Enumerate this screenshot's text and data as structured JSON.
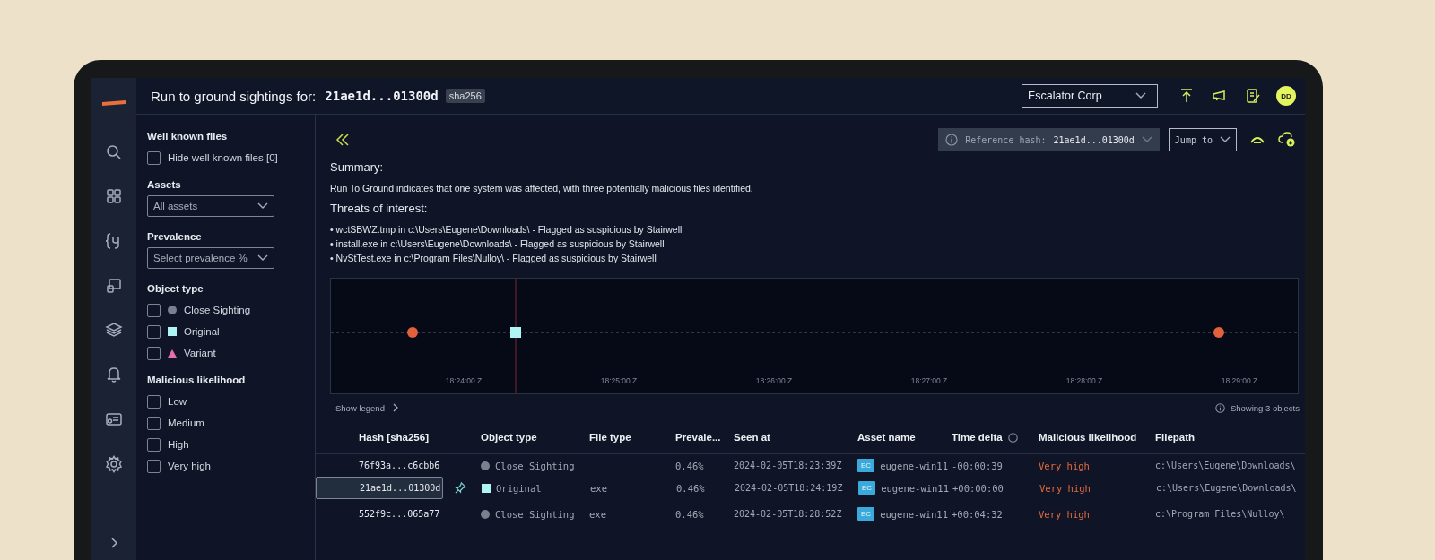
{
  "header": {
    "title": "Run to ground sightings for:",
    "hash": "21ae1d...01300d",
    "hash_type": "sha256",
    "org_select": "Escalator Corp",
    "avatar": "DD"
  },
  "filters": {
    "well_known": {
      "heading": "Well known files",
      "label": "Hide well known files [0]",
      "checked": false
    },
    "assets": {
      "heading": "Assets",
      "value": "All assets"
    },
    "prevalence": {
      "heading": "Prevalence",
      "placeholder": "Select prevalence %"
    },
    "object_type": {
      "heading": "Object type",
      "items": [
        {
          "label": "Close Sighting",
          "kind": "circle",
          "color": "#7a808e",
          "checked": false
        },
        {
          "label": "Original",
          "kind": "square",
          "color": "#aef4f4",
          "checked": false
        },
        {
          "label": "Variant",
          "kind": "triangle",
          "color": "#e56fae",
          "checked": false
        }
      ]
    },
    "malicious": {
      "heading": "Malicious likelihood",
      "items": [
        {
          "label": "Low",
          "checked": false
        },
        {
          "label": "Medium",
          "checked": false
        },
        {
          "label": "High",
          "checked": false
        },
        {
          "label": "Very high",
          "checked": false
        }
      ]
    }
  },
  "toolbar": {
    "reference_label": "Reference hash:",
    "reference_value": "21ae1d...01300d",
    "jump_to": "Jump to"
  },
  "summary": {
    "heading": "Summary:",
    "text": "Run To Ground indicates that one system was affected, with three potentially malicious files identified.",
    "threats_heading": "Threats of interest:",
    "threats": [
      "• wctSBWZ.tmp in c:\\Users\\Eugene\\Downloads\\ - Flagged as suspicious by Stairwell",
      "• install.exe in c:\\Users\\Eugene\\Downloads\\ - Flagged as suspicious by Stairwell",
      "• NvStTest.exe in c:\\Program Files\\Nulloy\\ - Flagged as suspicious by Stairwell"
    ]
  },
  "timeline": {
    "tick_labels": [
      "18:24:00 Z",
      "18:25:00 Z",
      "18:26:00 Z",
      "18:27:00 Z",
      "18:28:00 Z",
      "18:29:00 Z"
    ],
    "show_legend": "Show legend",
    "count": "Showing 3 objects"
  },
  "table": {
    "columns": [
      {
        "label": "Hash [sha256]",
        "info": false
      },
      {
        "label": "Object type",
        "info": false
      },
      {
        "label": "File type",
        "info": false
      },
      {
        "label": "Prevale...",
        "info": false
      },
      {
        "label": "Seen at",
        "info": false
      },
      {
        "label": "Asset name",
        "info": false
      },
      {
        "label": "Time delta",
        "info": true
      },
      {
        "label": "Malicious likelihood",
        "info": false
      },
      {
        "label": "Filepath",
        "info": false
      }
    ],
    "rows": [
      {
        "selected": false,
        "hash": "76f93a...c6cbb6",
        "pinned": false,
        "kind": "circle",
        "object_type": "Close Sighting",
        "file_type": "",
        "prevalence": "0.46%",
        "seen_at": "2024-02-05T18:23:39Z",
        "asset_badge": "EC",
        "asset": "eugene-win11",
        "time_delta": "-00:00:39",
        "malicious": "Very high",
        "filepath": "c:\\Users\\Eugene\\Downloads\\"
      },
      {
        "selected": true,
        "hash": "21ae1d...01300d",
        "pinned": true,
        "kind": "square",
        "object_type": "Original",
        "file_type": "exe",
        "prevalence": "0.46%",
        "seen_at": "2024-02-05T18:24:19Z",
        "asset_badge": "EC",
        "asset": "eugene-win11",
        "time_delta": "+00:00:00",
        "malicious": "Very high",
        "filepath": "c:\\Users\\Eugene\\Downloads\\"
      },
      {
        "selected": false,
        "hash": "552f9c...065a77",
        "pinned": false,
        "kind": "circle",
        "object_type": "Close Sighting",
        "file_type": "exe",
        "prevalence": "0.46%",
        "seen_at": "2024-02-05T18:28:52Z",
        "asset_badge": "EC",
        "asset": "eugene-win11",
        "time_delta": "+00:04:32",
        "malicious": "Very high",
        "filepath": "c:\\Program Files\\Nulloy\\"
      }
    ]
  }
}
